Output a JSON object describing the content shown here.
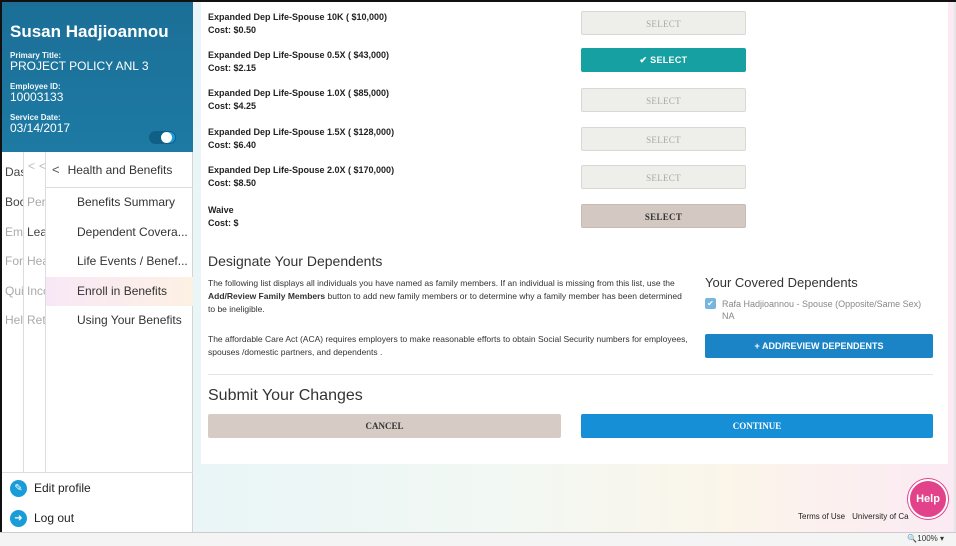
{
  "employee": {
    "name": "Susan Hadjioannou",
    "title_label": "Primary Title:",
    "title": "PROJECT POLICY ANL 3",
    "id_label": "Employee ID:",
    "id": "10003133",
    "service_label": "Service Date:",
    "service_date": "03/14/2017"
  },
  "nav": {
    "col1": [
      "Das",
      "Boc",
      "Emp",
      "For",
      "Qui",
      "Hel"
    ],
    "col2": [
      "Per",
      "Lea",
      "Hea",
      "Inco",
      "Ret"
    ],
    "col12_head": "<   <",
    "section_title": "Health and Benefits",
    "items": [
      "Benefits Summary",
      "Dependent Covera...",
      "Life Events / Benef...",
      "Enroll in Benefits",
      "Using Your Benefits"
    ]
  },
  "sidebar_footer": {
    "edit_profile": "Edit profile",
    "log_out": "Log out"
  },
  "options": [
    {
      "name": "Expanded Dep Life-Spouse 10K ( $10,000)",
      "cost": "Cost: $0.50",
      "button": "SELECT",
      "state": "off"
    },
    {
      "name": "Expanded Dep Life-Spouse 0.5X ( $43,000)",
      "cost": "Cost: $2.15",
      "button": "✔ SELECT",
      "state": "on"
    },
    {
      "name": "Expanded Dep Life-Spouse 1.0X ( $85,000)",
      "cost": "Cost: $4.25",
      "button": "SELECT",
      "state": "off"
    },
    {
      "name": "Expanded Dep Life-Spouse 1.5X ( $128,000)",
      "cost": "Cost: $6.40",
      "button": "SELECT",
      "state": "off"
    },
    {
      "name": "Expanded Dep Life-Spouse 2.0X ( $170,000)",
      "cost": "Cost: $8.50",
      "button": "SELECT",
      "state": "off"
    },
    {
      "name": "Waive",
      "cost": "Cost: $",
      "button": "SELECT",
      "state": "waive"
    }
  ],
  "dependents": {
    "title": "Designate Your Dependents",
    "p1_a": "The following list displays all individuals you have named as family members. If an individual is missing from this list, use the ",
    "p1_bold": "Add/Review Family Members",
    "p1_b": " button to add new family members or to determine why a family member has been determined to be ineligible.",
    "p2": "The affordable Care Act (ACA) requires employers to make reasonable efforts to obtain Social Security numbers for employees, spouses /domestic partners, and dependents .",
    "covered_title": "Your Covered Dependents",
    "covered_name": "Rafa Hadjioannou - Spouse (Opposite/Same Sex)",
    "covered_sub": "NA",
    "add_button": "+ ADD/REVIEW DEPENDENTS"
  },
  "submit": {
    "title": "Submit Your Changes",
    "cancel": "CANCEL",
    "continue": "CONTINUE"
  },
  "footer": {
    "terms": "Terms of Use",
    "university": "University of Ca"
  },
  "help": "Help",
  "zoom": " 🔍100% ▾",
  "colors": {
    "sidebar_blue": "#1d7aa3",
    "select_active": "#16a0a2",
    "continue_blue": "#168fd6",
    "help_pink": "#e1428a"
  }
}
